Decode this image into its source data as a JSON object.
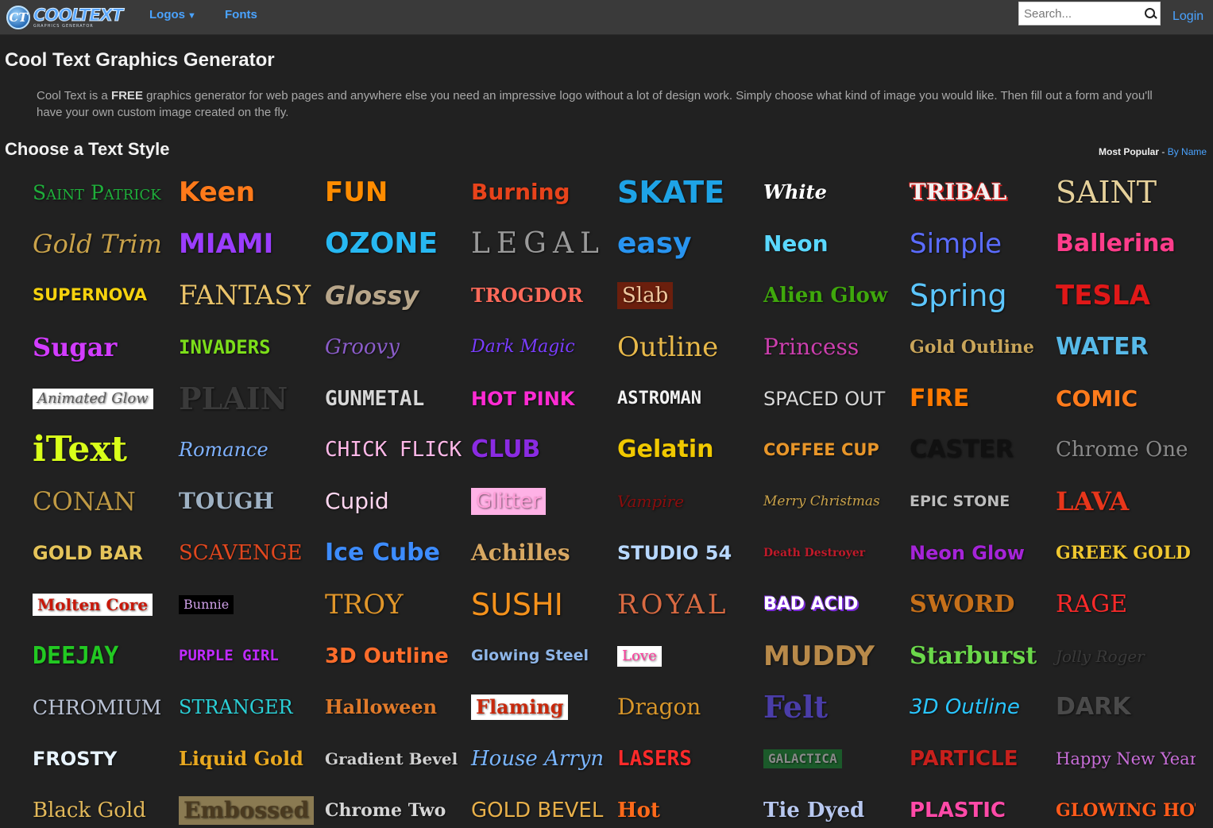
{
  "nav": {
    "logo_word": "COOLTEXT",
    "logo_sub": "GRAPHICS GENERATOR",
    "logo_mark": "CT",
    "logos": "Logos",
    "fonts": "Fonts",
    "search_placeholder": "Search...",
    "login": "Login"
  },
  "page": {
    "title": "Cool Text Graphics Generator",
    "intro_before": "Cool Text is a ",
    "intro_bold": "FREE",
    "intro_after": " graphics generator for web pages and anywhere else you need an impressive logo without a lot of design work. Simply choose what kind of image you would like. Then fill out a form and you'll have your own custom image created on the fly.",
    "choose_heading": "Choose a Text Style",
    "sort_current": "Most Popular",
    "sort_separator": " - ",
    "sort_alt": "By Name"
  },
  "styles": [
    {
      "name": "Saint Patrick",
      "fg": "#1fae3b",
      "font": "serif",
      "size": 25,
      "caps": true
    },
    {
      "name": "Keen",
      "fg": "#ff7a1a",
      "font": "sans",
      "size": 34,
      "bold": true
    },
    {
      "name": "FUN",
      "fg": "#ff8c00",
      "font": "sans",
      "size": 34,
      "bold": true
    },
    {
      "name": "Burning",
      "fg": "#e8431b",
      "font": "sans",
      "size": 28,
      "bold": true
    },
    {
      "name": "SKATE",
      "fg": "#1ea3e6",
      "font": "sans",
      "size": 38,
      "bold": true
    },
    {
      "name": "White",
      "fg": "#ffffff",
      "font": "serif",
      "size": 24,
      "bold": true,
      "italic": true
    },
    {
      "name": "TRIBAL",
      "fg": "#f2f2f2",
      "font": "serif",
      "size": 28,
      "bold": true,
      "shadow": "#d2201e"
    },
    {
      "name": "SAINT",
      "fg": "#e5d09a",
      "font": "serif",
      "size": 38
    },
    {
      "name": "Gold Trim",
      "fg": "#c9a24a",
      "font": "serif",
      "size": 32,
      "italic": true
    },
    {
      "name": "MIAMI",
      "fg": "#9b3dff",
      "font": "sans",
      "size": 34,
      "bold": true
    },
    {
      "name": "OZONE",
      "fg": "#27b8f2",
      "font": "sans",
      "size": 36,
      "bold": true
    },
    {
      "name": "LEGAL",
      "fg": "#9a9a9a",
      "font": "serif",
      "size": 36,
      "spacing": 8
    },
    {
      "name": "easy",
      "fg": "#2894f0",
      "font": "sans",
      "size": 36,
      "bold": true
    },
    {
      "name": "Neon",
      "fg": "#5ad8ff",
      "font": "sans",
      "size": 28,
      "bold": true
    },
    {
      "name": "Simple",
      "fg": "#5b6cff",
      "font": "sans",
      "size": 34
    },
    {
      "name": "Ballerina",
      "fg": "#ff3d8b",
      "font": "sans",
      "size": 30,
      "bold": true
    },
    {
      "name": "SUPERNOVA",
      "fg": "#f5d20e",
      "font": "sans",
      "size": 21,
      "bold": true
    },
    {
      "name": "FANTASY",
      "fg": "#e9c36a",
      "font": "serif",
      "size": 34
    },
    {
      "name": "Glossy",
      "fg": "#b8a68a",
      "font": "sans",
      "size": 32,
      "bold": true,
      "italic": true
    },
    {
      "name": "TROGDOR",
      "fg": "#ff6a5a",
      "font": "serif",
      "size": 24,
      "bold": true
    },
    {
      "name": "Slab",
      "fg": "#f0c9a0",
      "font": "serif",
      "size": 26,
      "bg": "#6b1f0d"
    },
    {
      "name": "Alien Glow",
      "fg": "#3fa80c",
      "font": "serif",
      "size": 26,
      "bold": true
    },
    {
      "name": "Spring",
      "fg": "#5cc6ff",
      "font": "sans",
      "size": 38
    },
    {
      "name": "TESLA",
      "fg": "#e01818",
      "font": "sans",
      "size": 34,
      "bold": true
    },
    {
      "name": "Sugar",
      "fg": "#d23cff",
      "font": "serif",
      "size": 32,
      "bold": true
    },
    {
      "name": "INVADERS",
      "fg": "#7cde1a",
      "font": "mono",
      "size": 24,
      "bold": true
    },
    {
      "name": "Groovy",
      "fg": "#8a5cc9",
      "font": "serif",
      "size": 26,
      "italic": true
    },
    {
      "name": "Dark Magic",
      "fg": "#7a3dff",
      "font": "serif",
      "size": 22,
      "italic": true
    },
    {
      "name": "Outline",
      "fg": "#e8b94a",
      "font": "serif",
      "size": 34
    },
    {
      "name": "Princess",
      "fg": "#cc3fae",
      "font": "serif",
      "size": 28
    },
    {
      "name": "Gold Outline",
      "fg": "#c9a55a",
      "font": "serif",
      "size": 22,
      "bold": true
    },
    {
      "name": "WATER",
      "fg": "#57b9e8",
      "font": "sans",
      "size": 30,
      "bold": true
    },
    {
      "name": "Animated Glow",
      "fg": "#5a5a5a",
      "font": "serif",
      "size": 18,
      "italic": true,
      "bg": "#ffffff"
    },
    {
      "name": "PLAIN",
      "fg": "#3a3a3a",
      "font": "serif",
      "size": 38,
      "bold": true
    },
    {
      "name": "GUNMETAL",
      "fg": "#d7d7d7",
      "font": "mono",
      "size": 26,
      "bold": true
    },
    {
      "name": "HOT PINK",
      "fg": "#ff2bd3",
      "font": "sans",
      "size": 24,
      "bold": true
    },
    {
      "name": "ASTROMAN",
      "fg": "#f2f2f2",
      "font": "mono",
      "size": 22,
      "bold": true
    },
    {
      "name": "SPACED OUT",
      "fg": "#d8d8d8",
      "font": "sans",
      "size": 24
    },
    {
      "name": "FIRE",
      "fg": "#ff7a00",
      "font": "sans",
      "size": 30,
      "bold": true
    },
    {
      "name": "COMIC",
      "fg": "#ff7b1c",
      "font": "sans",
      "size": 28,
      "bold": true
    },
    {
      "name": "iText",
      "fg": "#d9ff1a",
      "font": "serif",
      "size": 44,
      "bold": true
    },
    {
      "name": "Romance",
      "fg": "#7fb2ff",
      "font": "serif",
      "size": 24,
      "italic": true
    },
    {
      "name": "CHICK FLICK",
      "fg": "#ffb8e8",
      "font": "mono",
      "size": 26
    },
    {
      "name": "CLUB",
      "fg": "#8a2be2",
      "font": "sans",
      "size": 30,
      "bold": true
    },
    {
      "name": "Gelatin",
      "fg": "#f0c800",
      "font": "sans",
      "size": 30,
      "bold": true
    },
    {
      "name": "COFFEE CUP",
      "fg": "#e8962a",
      "font": "sans",
      "size": 21,
      "bold": true
    },
    {
      "name": "CASTER",
      "fg": "#111111",
      "font": "sans",
      "size": 30,
      "bold": true
    },
    {
      "name": "Chrome One",
      "fg": "#8a8a8a",
      "font": "serif",
      "size": 26
    },
    {
      "name": "CONAN",
      "fg": "#c09a44",
      "font": "serif",
      "size": 32
    },
    {
      "name": "TOUGH",
      "fg": "#9fb2c4",
      "font": "serif",
      "size": 28,
      "bold": true
    },
    {
      "name": "Cupid",
      "fg": "#ffd6f0",
      "font": "sans",
      "size": 28
    },
    {
      "name": "Glitter",
      "fg": "#ff9ed8",
      "font": "sans",
      "size": 26,
      "bg": "#ffb2e6"
    },
    {
      "name": "Vampire",
      "fg": "#8a0d0d",
      "font": "serif",
      "size": 20,
      "italic": true
    },
    {
      "name": "Merry Christmas",
      "fg": "#c9a24a",
      "font": "serif",
      "size": 17,
      "italic": true
    },
    {
      "name": "EPIC STONE",
      "fg": "#bdbdbd",
      "font": "sans",
      "size": 19,
      "bold": true
    },
    {
      "name": "LAVA",
      "fg": "#e8361b",
      "font": "serif",
      "size": 32,
      "bold": true
    },
    {
      "name": "GOLD BAR",
      "fg": "#e5c45a",
      "font": "sans",
      "size": 24,
      "bold": true
    },
    {
      "name": "SCAVENGE",
      "fg": "#e1471e",
      "font": "serif",
      "size": 26
    },
    {
      "name": "Ice Cube",
      "fg": "#3d8cff",
      "font": "sans",
      "size": 30,
      "bold": true
    },
    {
      "name": "Achilles",
      "fg": "#d8a862",
      "font": "serif",
      "size": 28,
      "bold": true
    },
    {
      "name": "STUDIO 54",
      "fg": "#b8d8ff",
      "font": "sans",
      "size": 24,
      "bold": true
    },
    {
      "name": "Death Destroyer",
      "fg": "#c01a2a",
      "font": "serif",
      "size": 14,
      "bold": true
    },
    {
      "name": "Neon Glow",
      "fg": "#a524d8",
      "font": "sans",
      "size": 24,
      "bold": true
    },
    {
      "name": "GREEK GOLD",
      "fg": "#f0c830",
      "font": "serif",
      "size": 22,
      "bold": true
    },
    {
      "name": "Molten Core",
      "fg": "#c8180a",
      "font": "serif",
      "size": 20,
      "bold": true,
      "bg": "#ffffff"
    },
    {
      "name": "Bunnie",
      "fg": "#cfa0e8",
      "font": "serif",
      "size": 16,
      "bg": "#000000"
    },
    {
      "name": "TROY",
      "fg": "#e0962a",
      "font": "serif",
      "size": 34
    },
    {
      "name": "SUSHI",
      "fg": "#f5921c",
      "font": "sans",
      "size": 38
    },
    {
      "name": "ROYAL",
      "fg": "#d96a42",
      "font": "serif",
      "size": 34,
      "spacing": 4
    },
    {
      "name": "BAD ACID",
      "fg": "#ffffff",
      "font": "sans",
      "size": 22,
      "bold": true,
      "shadow": "#7a2bd8"
    },
    {
      "name": "SWORD",
      "fg": "#c6701a",
      "font": "serif",
      "size": 30,
      "bold": true
    },
    {
      "name": "RAGE",
      "fg": "#ff2a2a",
      "font": "serif",
      "size": 30
    },
    {
      "name": "DEEJAY",
      "fg": "#22c922",
      "font": "mono",
      "size": 30,
      "bold": true
    },
    {
      "name": "PURPLE GIRL",
      "fg": "#c02bff",
      "font": "mono",
      "size": 19,
      "bold": true
    },
    {
      "name": "3D Outline",
      "fg": "#ff6d2b",
      "font": "sans",
      "size": 26,
      "bold": true
    },
    {
      "name": "Glowing Steel",
      "fg": "#8fb6e8",
      "font": "sans",
      "size": 19,
      "bold": true
    },
    {
      "name": "Love",
      "fg": "#ff3d9e",
      "font": "serif",
      "size": 18,
      "bg": "#ffffff"
    },
    {
      "name": "MUDDY",
      "fg": "#b88a4a",
      "font": "sans",
      "size": 34,
      "bold": true
    },
    {
      "name": "Starburst",
      "fg": "#6bd84a",
      "font": "serif",
      "size": 30,
      "bold": true
    },
    {
      "name": "Jolly Roger",
      "fg": "#3a3a3a",
      "font": "serif",
      "size": 20,
      "italic": true
    },
    {
      "name": "CHROMIUM",
      "fg": "#bac3d6",
      "font": "serif",
      "size": 25
    },
    {
      "name": "STRANGER",
      "fg": "#2bcfd6",
      "font": "serif",
      "size": 24
    },
    {
      "name": "Halloween",
      "fg": "#e07a2a",
      "font": "serif",
      "size": 24,
      "bold": true
    },
    {
      "name": "Flaming",
      "fg": "#c8280c",
      "font": "serif",
      "size": 24,
      "bold": true,
      "bg": "#ffffff"
    },
    {
      "name": "Dragon",
      "fg": "#d8962a",
      "font": "serif",
      "size": 28
    },
    {
      "name": "Felt",
      "fg": "#4a3da8",
      "font": "serif",
      "size": 38,
      "bold": true
    },
    {
      "name": "3D Outline",
      "fg": "#2ac6ff",
      "font": "sans",
      "size": 26,
      "italic": true
    },
    {
      "name": "DARK",
      "fg": "#4a4a4a",
      "font": "sans",
      "size": 30,
      "bold": true
    },
    {
      "name": "FROSTY",
      "fg": "#e8f4ff",
      "font": "sans",
      "size": 24,
      "bold": true
    },
    {
      "name": "Liquid Gold",
      "fg": "#e8a820",
      "font": "serif",
      "size": 24,
      "bold": true
    },
    {
      "name": "Gradient Bevel",
      "fg": "#cfcfcf",
      "font": "serif",
      "size": 20,
      "bold": true
    },
    {
      "name": "House Arryn",
      "fg": "#7ab6ff",
      "font": "serif",
      "size": 26,
      "italic": true
    },
    {
      "name": "LASERS",
      "fg": "#ff2a2a",
      "font": "mono",
      "size": 26,
      "bold": true
    },
    {
      "name": "GALACTICA",
      "fg": "#8a8a8a",
      "font": "mono",
      "size": 16,
      "bold": true,
      "bg": "#1b5a2a"
    },
    {
      "name": "PARTICLE",
      "fg": "#c8201c",
      "font": "sans",
      "size": 26,
      "bold": true
    },
    {
      "name": "Happy New Year",
      "fg": "#c86ed8",
      "font": "serif",
      "size": 21
    },
    {
      "name": "Black Gold",
      "fg": "#e2b85a",
      "font": "serif",
      "size": 26
    },
    {
      "name": "Embossed",
      "fg": "#4a3a20",
      "font": "serif",
      "size": 28,
      "bold": true,
      "bg": "#8a7a52"
    },
    {
      "name": "Chrome Two",
      "fg": "#d6d6d6",
      "font": "serif",
      "size": 22,
      "bold": true
    },
    {
      "name": "GOLD BEVEL",
      "fg": "#e8b04a",
      "font": "sans",
      "size": 26
    },
    {
      "name": "Hot",
      "fg": "#ff6a1a",
      "font": "serif",
      "size": 26,
      "bold": true
    },
    {
      "name": "Tie Dyed",
      "fg": "#b8c8f0",
      "font": "serif",
      "size": 26,
      "bold": true
    },
    {
      "name": "PLASTIC",
      "fg": "#ff4aa8",
      "font": "sans",
      "size": 26,
      "bold": true
    },
    {
      "name": "GLOWING HOT",
      "fg": "#ff5a1a",
      "font": "serif",
      "size": 22,
      "bold": true
    }
  ]
}
